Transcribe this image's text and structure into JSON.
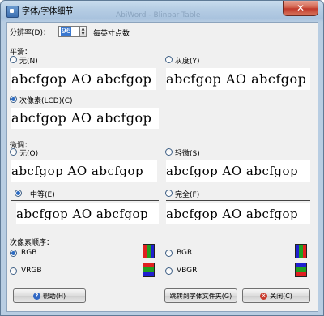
{
  "window": {
    "title": "字体/字体细节",
    "ghost_title": "AbiWord - Blinbar Table",
    "close_symbol": "✕"
  },
  "resolution": {
    "label": "分辨率(D)：",
    "value": "96",
    "unit": "每英寸点数"
  },
  "smoothing": {
    "heading": "平滑：",
    "options": [
      {
        "label": "无(N)",
        "checked": false
      },
      {
        "label": "灰度(Y)",
        "checked": false
      },
      {
        "label": "次像素(LCD)(C)",
        "checked": true
      }
    ],
    "sample_text": "abcfgop AO abcfgop"
  },
  "hinting": {
    "heading": "微调：",
    "options": [
      {
        "label": "无(O)",
        "checked": false
      },
      {
        "label": "轻微(S)",
        "checked": false
      },
      {
        "label": "中等(E)",
        "checked": true
      },
      {
        "label": "完全(F)",
        "checked": false
      }
    ],
    "sample_text": "abcfgop AO abcfgop"
  },
  "subpixel_order": {
    "heading": "次像素顺序：",
    "options": [
      {
        "label": "RGB",
        "checked": true
      },
      {
        "label": "BGR",
        "checked": false
      },
      {
        "label": "VRGB",
        "checked": false
      },
      {
        "label": "VBGR",
        "checked": false
      }
    ],
    "colors": {
      "red": "#e02020",
      "green": "#20a020",
      "blue": "#2020d0"
    }
  },
  "buttons": {
    "help": "帮助(H)",
    "go_to_folder": "跳转到字体文件夹(G)",
    "close": "关闭(C)"
  }
}
